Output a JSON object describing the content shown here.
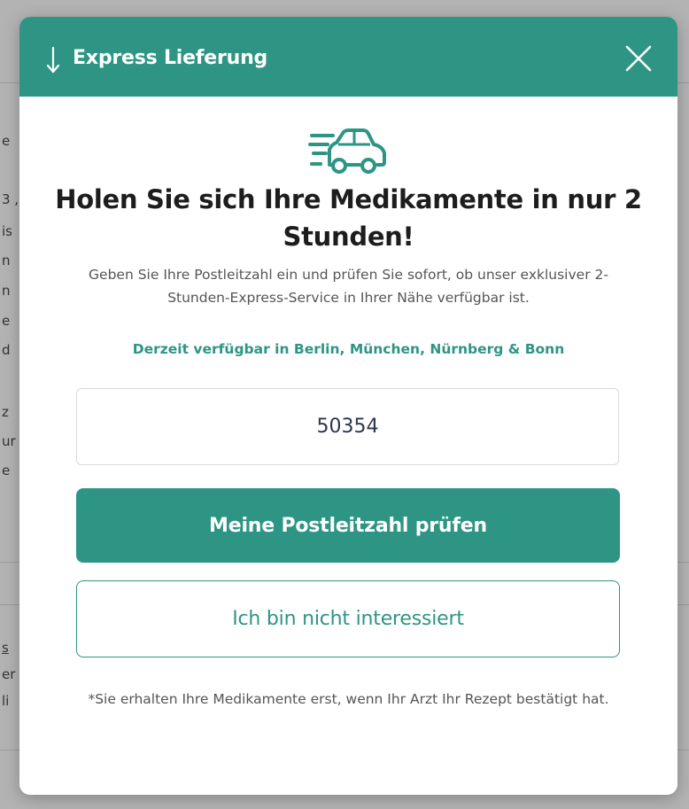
{
  "background": {
    "fragments": [
      "e",
      "3 ,",
      "is",
      "n",
      "n",
      "e",
      "d",
      "z",
      "ur",
      "e",
      "s",
      "er",
      "li"
    ]
  },
  "modal": {
    "header": {
      "icon": "arrow-down-icon",
      "title": "Express Lieferung",
      "close_icon": "close-icon"
    },
    "hero_icon": "delivery-car-icon",
    "headline": "Holen Sie sich Ihre Medikamente in nur 2 Stunden!",
    "description": "Geben Sie Ihre Postleitzahl ein und prüfen Sie sofort, ob unser exklusiver 2-Stunden-Express-Service in Ihrer Nähe verfügbar ist.",
    "availability": "Derzeit verfügbar in Berlin, München, Nürnberg & Bonn",
    "zip_input": {
      "value": "50354"
    },
    "check_button": "Meine Postleitzahl prüfen",
    "decline_button": "Ich bin nicht interessiert",
    "footnote": "*Sie erhalten Ihre Medikamente erst, wenn Ihr Arzt Ihr Rezept bestätigt hat."
  },
  "colors": {
    "accent": "#2e9584",
    "overlay": "#8a8a8a",
    "text_dark": "#1d1d1d",
    "text_muted": "#555555",
    "input_text": "#2c3550"
  }
}
